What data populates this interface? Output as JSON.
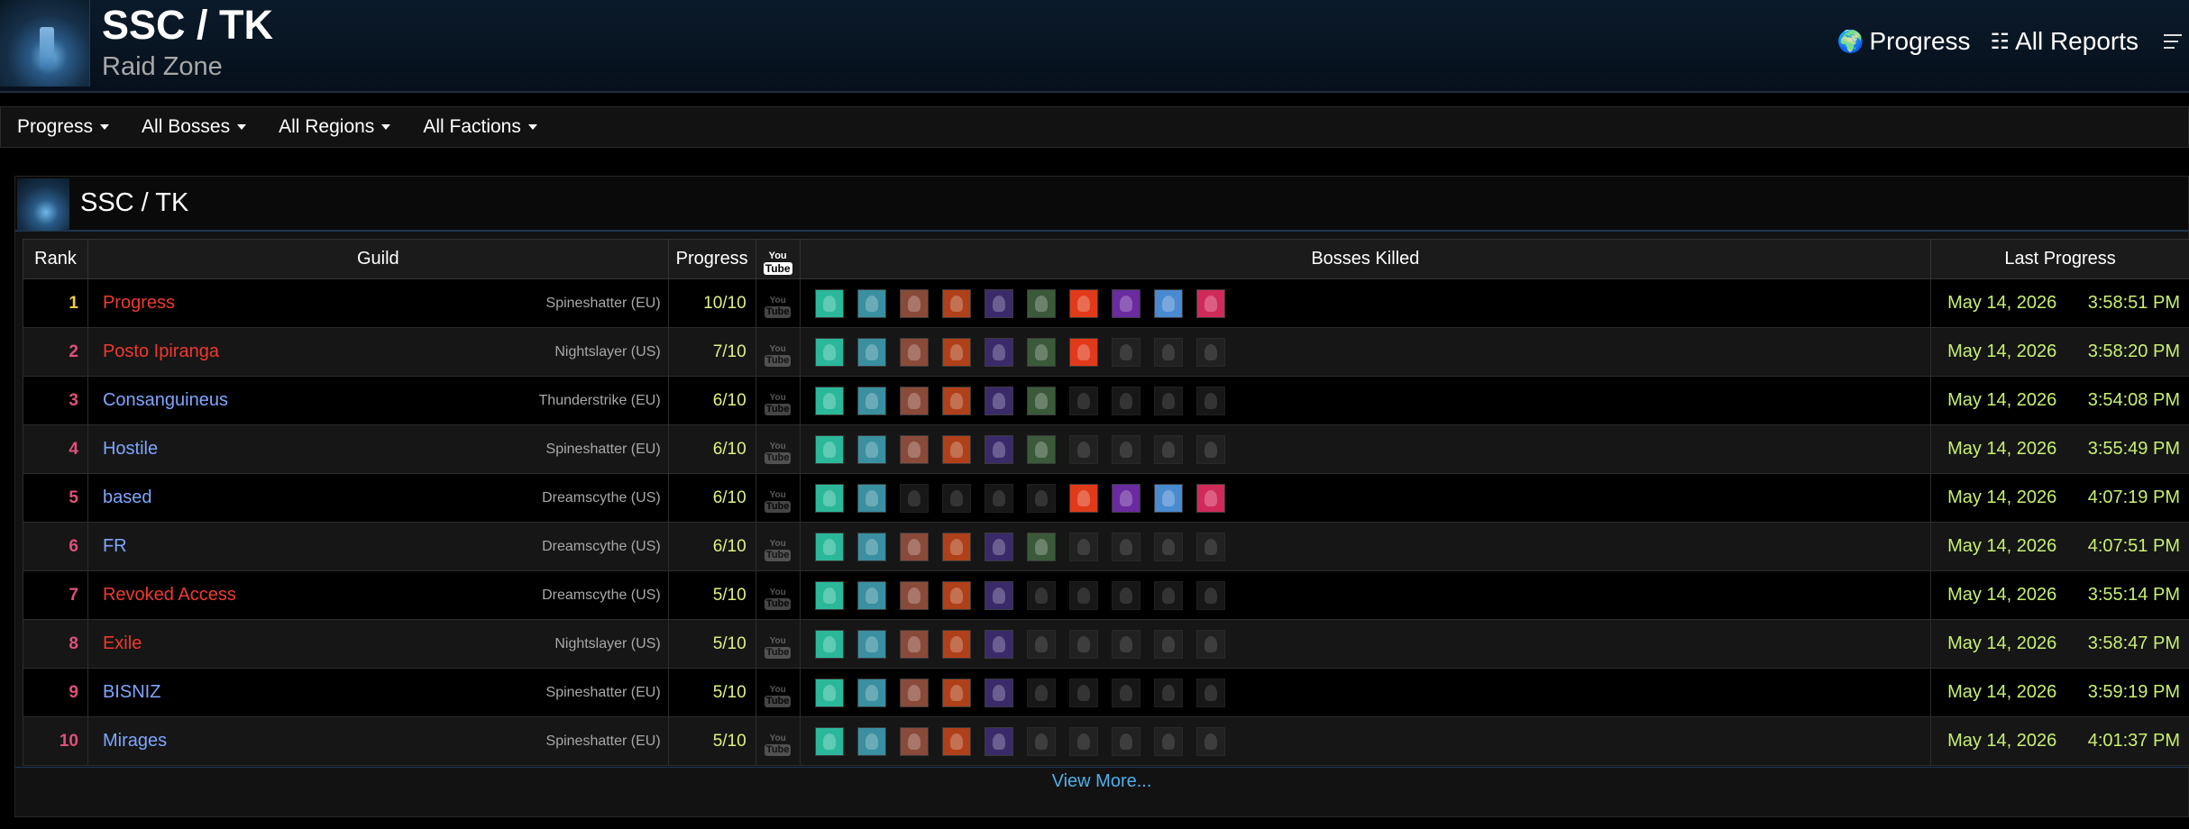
{
  "header": {
    "title": "SSC / TK",
    "subtitle": "Raid Zone",
    "nav": [
      {
        "label": "Progress",
        "icon": "globe-icon",
        "glyph": "🌍"
      },
      {
        "label": "All Reports",
        "icon": "list-icon",
        "glyph": "☷"
      }
    ]
  },
  "filters": [
    {
      "label": "Progress"
    },
    {
      "label": "All Bosses"
    },
    {
      "label": "All Regions"
    },
    {
      "label": "All Factions"
    }
  ],
  "panel": {
    "title": "SSC / TK",
    "columns": {
      "rank": "Rank",
      "guild": "Guild",
      "progress": "Progress",
      "youtube_you": "You",
      "youtube_tube": "Tube",
      "bosses": "Bosses Killed",
      "last": "Last Progress"
    },
    "view_more": "View More..."
  },
  "colors": {
    "rank_top": "#f0d040",
    "rank_other": "#e0507a",
    "guild_red": "#ee3a2e",
    "guild_blue": "#7ea6ff",
    "accent_link": "#4fb0ea",
    "progress_text": "#e0f080",
    "date_text": "#c8f070"
  },
  "boss_colors": [
    "#2bb89a",
    "#3a8fa0",
    "#8a4a3a",
    "#b0401a",
    "#3a2a6a",
    "#3a5a3a",
    "#e03a1a",
    "#6a2aa0",
    "#4a8ad0",
    "#d02a5a"
  ],
  "rows": [
    {
      "rank": "1",
      "guild": "Progress",
      "faction": "horde",
      "server": "Spineshatter (EU)",
      "progress": "10/10",
      "kills": [
        1,
        1,
        1,
        1,
        1,
        1,
        1,
        1,
        1,
        1
      ],
      "date": "May 14, 2026",
      "time": "3:58:51 PM"
    },
    {
      "rank": "2",
      "guild": "Posto Ipiranga",
      "faction": "horde",
      "server": "Nightslayer (US)",
      "progress": "7/10",
      "kills": [
        1,
        1,
        1,
        1,
        1,
        1,
        1,
        0,
        0,
        0
      ],
      "date": "May 14, 2026",
      "time": "3:58:20 PM"
    },
    {
      "rank": "3",
      "guild": "Consanguineus",
      "faction": "alliance",
      "server": "Thunderstrike (EU)",
      "progress": "6/10",
      "kills": [
        1,
        1,
        1,
        1,
        1,
        1,
        0,
        0,
        0,
        0
      ],
      "date": "May 14, 2026",
      "time": "3:54:08 PM"
    },
    {
      "rank": "4",
      "guild": "Hostile",
      "faction": "alliance",
      "server": "Spineshatter (EU)",
      "progress": "6/10",
      "kills": [
        1,
        1,
        1,
        1,
        1,
        1,
        0,
        0,
        0,
        0
      ],
      "date": "May 14, 2026",
      "time": "3:55:49 PM"
    },
    {
      "rank": "5",
      "guild": "based",
      "faction": "alliance",
      "server": "Dreamscythe (US)",
      "progress": "6/10",
      "kills": [
        1,
        1,
        0,
        0,
        0,
        0,
        1,
        1,
        1,
        1
      ],
      "date": "May 14, 2026",
      "time": "4:07:19 PM"
    },
    {
      "rank": "6",
      "guild": "FR",
      "faction": "alliance",
      "server": "Dreamscythe (US)",
      "progress": "6/10",
      "kills": [
        1,
        1,
        1,
        1,
        1,
        1,
        0,
        0,
        0,
        0
      ],
      "date": "May 14, 2026",
      "time": "4:07:51 PM"
    },
    {
      "rank": "7",
      "guild": "Revoked Access",
      "faction": "horde",
      "server": "Dreamscythe (US)",
      "progress": "5/10",
      "kills": [
        1,
        1,
        1,
        1,
        1,
        0,
        0,
        0,
        0,
        0
      ],
      "date": "May 14, 2026",
      "time": "3:55:14 PM"
    },
    {
      "rank": "8",
      "guild": "Exile",
      "faction": "horde",
      "server": "Nightslayer (US)",
      "progress": "5/10",
      "kills": [
        1,
        1,
        1,
        1,
        1,
        0,
        0,
        0,
        0,
        0
      ],
      "date": "May 14, 2026",
      "time": "3:58:47 PM"
    },
    {
      "rank": "9",
      "guild": "BISNIZ",
      "faction": "alliance",
      "server": "Spineshatter (EU)",
      "progress": "5/10",
      "kills": [
        1,
        1,
        1,
        1,
        1,
        0,
        0,
        0,
        0,
        0
      ],
      "date": "May 14, 2026",
      "time": "3:59:19 PM"
    },
    {
      "rank": "10",
      "guild": "Mirages",
      "faction": "alliance",
      "server": "Spineshatter (EU)",
      "progress": "5/10",
      "kills": [
        1,
        1,
        1,
        1,
        1,
        0,
        0,
        0,
        0,
        0
      ],
      "date": "May 14, 2026",
      "time": "4:01:37 PM"
    }
  ]
}
